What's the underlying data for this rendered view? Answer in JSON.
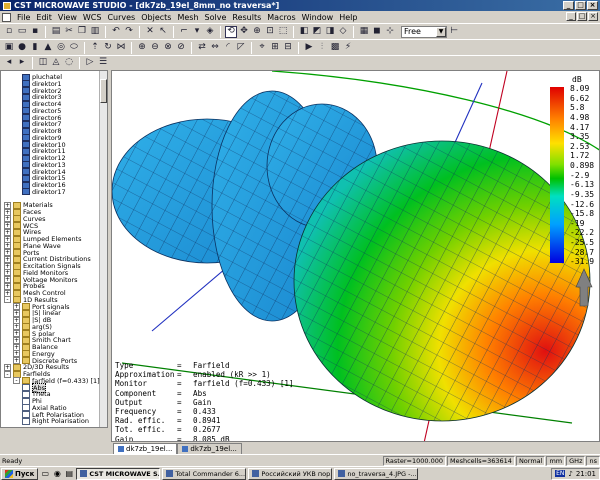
{
  "window": {
    "title": "CST MICROWAVE STUDIO - [dk7zb_19el_8mm_no traversa*]",
    "buttons": [
      "_",
      "□",
      "×"
    ]
  },
  "menu": {
    "items": [
      "File",
      "Edit",
      "View",
      "WCS",
      "Curves",
      "Objects",
      "Mesh",
      "Solve",
      "Results",
      "Macros",
      "Window",
      "Help"
    ]
  },
  "toolbar": {
    "view_combo": "Free"
  },
  "tree": {
    "items": [
      {
        "label": "pluchatel",
        "indent": 2,
        "icon": "solid"
      },
      {
        "label": "direktor1",
        "indent": 2,
        "icon": "solid"
      },
      {
        "label": "direktor2",
        "indent": 2,
        "icon": "solid"
      },
      {
        "label": "direktor3",
        "indent": 2,
        "icon": "solid"
      },
      {
        "label": "director4",
        "indent": 2,
        "icon": "solid"
      },
      {
        "label": "director5",
        "indent": 2,
        "icon": "solid"
      },
      {
        "label": "director6",
        "indent": 2,
        "icon": "solid"
      },
      {
        "label": "direktor7",
        "indent": 2,
        "icon": "solid"
      },
      {
        "label": "direktor8",
        "indent": 2,
        "icon": "solid"
      },
      {
        "label": "direktor9",
        "indent": 2,
        "icon": "solid"
      },
      {
        "label": "direktor10",
        "indent": 2,
        "icon": "solid"
      },
      {
        "label": "direktor11",
        "indent": 2,
        "icon": "solid"
      },
      {
        "label": "direktor12",
        "indent": 2,
        "icon": "solid"
      },
      {
        "label": "direktor13",
        "indent": 2,
        "icon": "solid"
      },
      {
        "label": "direktor14",
        "indent": 2,
        "icon": "solid"
      },
      {
        "label": "direktor15",
        "indent": 2,
        "icon": "solid"
      },
      {
        "label": "direktor16",
        "indent": 2,
        "icon": "solid"
      },
      {
        "label": "direktor17",
        "indent": 2,
        "icon": "solid"
      },
      {
        "label": "",
        "indent": 0,
        "icon": "none"
      },
      {
        "label": "Materials",
        "indent": 0,
        "icon": "folder",
        "exp": "+"
      },
      {
        "label": "Faces",
        "indent": 0,
        "icon": "folder",
        "exp": "+"
      },
      {
        "label": "Curves",
        "indent": 0,
        "icon": "folder",
        "exp": "+"
      },
      {
        "label": "WCS",
        "indent": 0,
        "icon": "folder",
        "exp": "+"
      },
      {
        "label": "Wires",
        "indent": 0,
        "icon": "folder",
        "exp": "+"
      },
      {
        "label": "Lumped Elements",
        "indent": 0,
        "icon": "folder",
        "exp": "+"
      },
      {
        "label": "Plane Wave",
        "indent": 0,
        "icon": "folder",
        "exp": "+"
      },
      {
        "label": "Ports",
        "indent": 0,
        "icon": "folder",
        "exp": "+"
      },
      {
        "label": "Current Distributions",
        "indent": 0,
        "icon": "folder",
        "exp": "+"
      },
      {
        "label": "Excitation Signals",
        "indent": 0,
        "icon": "folder",
        "exp": "+"
      },
      {
        "label": "Field Monitors",
        "indent": 0,
        "icon": "folder",
        "exp": "+"
      },
      {
        "label": "Voltage Monitors",
        "indent": 0,
        "icon": "folder",
        "exp": "+"
      },
      {
        "label": "Probes",
        "indent": 0,
        "icon": "folder",
        "exp": "+"
      },
      {
        "label": "Mesh Control",
        "indent": 0,
        "icon": "folder",
        "exp": "+"
      },
      {
        "label": "1D Results",
        "indent": 0,
        "icon": "folder",
        "exp": "-"
      },
      {
        "label": "Port signals",
        "indent": 1,
        "icon": "folder",
        "exp": "+"
      },
      {
        "label": "|S| linear",
        "indent": 1,
        "icon": "folder",
        "exp": "+"
      },
      {
        "label": "|S| dB",
        "indent": 1,
        "icon": "folder",
        "exp": "+"
      },
      {
        "label": "arg(S)",
        "indent": 1,
        "icon": "folder",
        "exp": "+"
      },
      {
        "label": "S polar",
        "indent": 1,
        "icon": "folder",
        "exp": "+"
      },
      {
        "label": "Smith Chart",
        "indent": 1,
        "icon": "folder",
        "exp": "+"
      },
      {
        "label": "Balance",
        "indent": 1,
        "icon": "folder",
        "exp": "+"
      },
      {
        "label": "Energy",
        "indent": 1,
        "icon": "folder",
        "exp": "+"
      },
      {
        "label": "Discrete Ports",
        "indent": 1,
        "icon": "folder",
        "exp": "+"
      },
      {
        "label": "2D/3D Results",
        "indent": 0,
        "icon": "folder",
        "exp": "+"
      },
      {
        "label": "Farfields",
        "indent": 0,
        "icon": "folder",
        "exp": "-"
      },
      {
        "label": "farfield (f=0.433) [1]",
        "indent": 1,
        "icon": "folder",
        "exp": "-"
      },
      {
        "label": "Abs",
        "indent": 2,
        "icon": "sheet",
        "selected": true
      },
      {
        "label": "Theta",
        "indent": 2,
        "icon": "sheet"
      },
      {
        "label": "Phi",
        "indent": 2,
        "icon": "sheet"
      },
      {
        "label": "Axial Ratio",
        "indent": 2,
        "icon": "sheet"
      },
      {
        "label": "Left Polarisation",
        "indent": 2,
        "icon": "sheet"
      },
      {
        "label": "Right Polarisation",
        "indent": 2,
        "icon": "sheet"
      }
    ]
  },
  "legend": {
    "unit": "dB",
    "labels": [
      "8.09",
      "6.62",
      "5.8",
      "4.98",
      "4.17",
      "3.35",
      "2.53",
      "1.72",
      "0.898",
      "-2.9",
      "-6.13",
      "-9.35",
      "-12.6",
      "-15.8",
      "-19",
      "-22.2",
      "-25.5",
      "-28.7",
      "-31.9"
    ],
    "colors": {
      "max": "#e00000",
      "mid": "#00c000",
      "min": "#0000e0"
    }
  },
  "info": [
    {
      "k": "Type",
      "v": "Farfield"
    },
    {
      "k": "Approximation",
      "v": "enabled (kR >> 1)"
    },
    {
      "k": "Monitor",
      "v": "farfield (f=0.433) [1]"
    },
    {
      "k": "Component",
      "v": "Abs"
    },
    {
      "k": "Output",
      "v": "Gain"
    },
    {
      "k": "Frequency",
      "v": "0.433"
    },
    {
      "k": "Rad. effic.",
      "v": "0.8941"
    },
    {
      "k": "Tot. effic.",
      "v": "0.2677"
    },
    {
      "k": "Gain",
      "v": "8.085 dB"
    }
  ],
  "doc_tabs": [
    "dk7zb_19el...",
    "dk7zb_19el..."
  ],
  "status": {
    "ready": "Ready",
    "raster": "Raster=1000.000",
    "mesh": "Meshcells=363614",
    "mode": "Normal",
    "units1": "mm",
    "units2": "GHz",
    "units3": "ns"
  },
  "taskbar": {
    "start": "Пуск",
    "tasks": [
      "CST MICROWAVE S...",
      "Total Commander 6....",
      "Российский УКВ пор...",
      "no_traversa_4.JPG -..."
    ],
    "lang": "EN",
    "clock": "21:01"
  }
}
